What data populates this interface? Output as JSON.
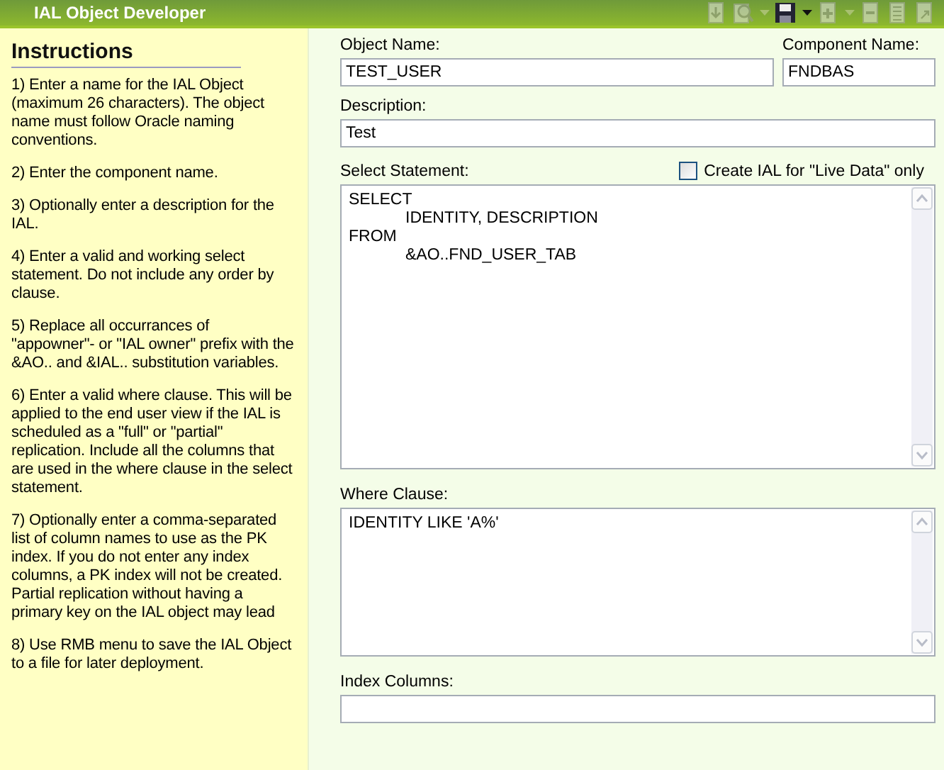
{
  "window": {
    "title": "IAL Object Developer"
  },
  "toolbar": [
    {
      "kind": "import",
      "disabled": true,
      "menu": false
    },
    {
      "kind": "find",
      "disabled": true,
      "menu": true
    },
    {
      "kind": "save",
      "disabled": false,
      "menu": true
    },
    {
      "kind": "new",
      "disabled": true,
      "menu": true
    },
    {
      "kind": "remove",
      "disabled": true,
      "menu": false
    },
    {
      "kind": "list",
      "disabled": true,
      "menu": false
    },
    {
      "kind": "export",
      "disabled": true,
      "menu": false
    }
  ],
  "instructions": {
    "title": "Instructions",
    "steps": [
      "1)  Enter a name for the IAL Object (maximum 26 characters). The object name must follow Oracle naming conventions.",
      "2)  Enter the component name.",
      "3)  Optionally enter a description for the IAL.",
      "4)  Enter a valid and working select statement. Do not include any order by clause.",
      "5)  Replace all occurrances of \"appowner\"- or \"IAL owner\" prefix with the &AO.. and &IAL.. substitution variables.",
      "6)  Enter a valid where clause. This will be applied to the end user view if the IAL is scheduled as a \"full\" or \"partial\" replication. Include all the columns that are used in the where clause in the select statement.",
      "7)  Optionally enter a comma-separated list of column names to use as the PK index. If you do not enter any index columns, a PK index will not be created. Partial replication without having a primary key on the IAL object may lead",
      "8)  Use RMB menu to save the IAL Object to a file for later deployment."
    ]
  },
  "form": {
    "object_name": {
      "label": "Object Name:",
      "value": "TEST_USER"
    },
    "component_name": {
      "label": "Component Name:",
      "value": "FNDBAS"
    },
    "description": {
      "label": "Description:",
      "value": "Test"
    },
    "select_statement": {
      "label": "Select Statement:",
      "lines": [
        {
          "text": "SELECT",
          "indented": false
        },
        {
          "text": "IDENTITY, DESCRIPTION",
          "indented": true
        },
        {
          "text": "FROM",
          "indented": false
        },
        {
          "text": "&AO..FND_USER_TAB",
          "indented": true
        }
      ]
    },
    "live_data": {
      "label": "Create IAL for \"Live Data\" only",
      "checked": false
    },
    "where_clause": {
      "label": "Where Clause:",
      "lines": [
        {
          "text": "IDENTITY LIKE 'A%'",
          "indented": false
        }
      ]
    },
    "index_columns": {
      "label": "Index Columns:"
    }
  }
}
